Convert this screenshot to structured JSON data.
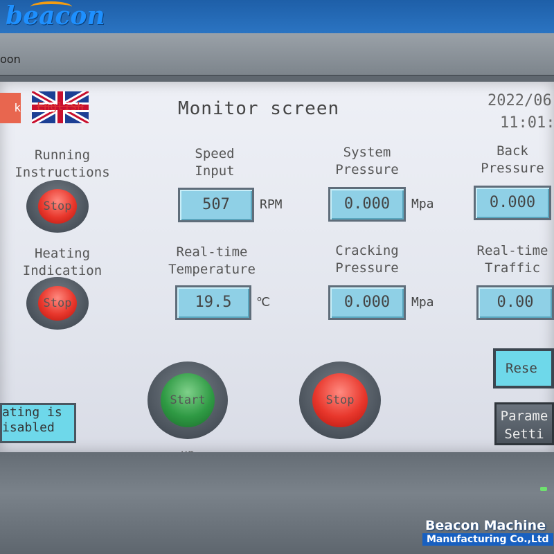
{
  "brand": {
    "logo_text": "beacon",
    "bezel_label": "oon",
    "watermark_line1": "Beacon Machine",
    "watermark_line2": "Manufacturing Co.,Ltd"
  },
  "header": {
    "lang_left_fragment": "k",
    "lang_english": "English",
    "title": "Monitor screen",
    "date": "2022/06",
    "time": "11:01:"
  },
  "indicators": {
    "running_label_line1": "Running",
    "running_label_line2": "Instructions",
    "running_state": "Stop",
    "heating_label_line1": "Heating",
    "heating_label_line2": "Indication",
    "heating_state": "Stop"
  },
  "readouts": {
    "speed": {
      "label_line1": "Speed",
      "label_line2": "Input",
      "value": "507",
      "unit": "RPM"
    },
    "system_pressure": {
      "label_line1": "System",
      "label_line2": "Pressure",
      "value": "0.000",
      "unit": "Mpa"
    },
    "back_pressure": {
      "label_line1": "Back",
      "label_line2": "Pressure",
      "value": "0.000"
    },
    "temperature": {
      "label_line1": "Real-time",
      "label_line2": "Temperature",
      "value": "19.5",
      "unit": "℃"
    },
    "cracking_pressure": {
      "label_line1": "Cracking",
      "label_line2": "Pressure",
      "value": "0.000",
      "unit": "Mpa"
    },
    "traffic": {
      "label_line1": "Real-time",
      "label_line2": "Traffic",
      "value": "0.00"
    }
  },
  "controls": {
    "start_label": "Start up",
    "stop_label": "Stop",
    "reset_label": "Rese",
    "params_line1": "Parame",
    "params_line2": "Setti",
    "heating_status_line1": "ating is",
    "heating_status_line2": "isabled"
  },
  "colors": {
    "value_box": "#8fd0e6",
    "stop_red": "#e8372c",
    "start_green": "#2f9a44",
    "status_cyan": "#6ed8ea"
  }
}
